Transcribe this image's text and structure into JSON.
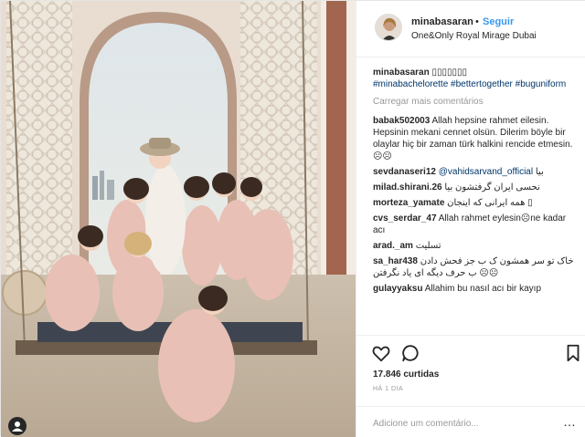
{
  "header": {
    "username": "minabasaran",
    "separator": "•",
    "follow_label": "Seguir",
    "location": "One&Only Royal Mirage Dubai"
  },
  "caption": {
    "user": "minabasaran",
    "text": "▯▯▯▯▯▯▯",
    "hashtags": "#minabachelorette #bettertogether #buguniform"
  },
  "load_more": "Carregar mais comentários",
  "comments": [
    {
      "user": "babak502003",
      "text": "Allah hepsine rahmet eilesin. Hepsinin mekani cennet olsün. Dilerim böyle bir olaylar hiç bir zaman türk halkini rencide etmesin. ☹☹",
      "mention": ""
    },
    {
      "user": "sevdanaseri12",
      "text": "بیا",
      "mention": "@vahidsarvand_official"
    },
    {
      "user": "milad.shirani.26",
      "text": "نحسی ایران گرفتشون بیا",
      "mention": ""
    },
    {
      "user": "morteza_yamate",
      "text": "همه ایرانی که اینجان ▯",
      "mention": ""
    },
    {
      "user": "cvs_serdar_47",
      "text": "Allah rahmet eylesin☹ne kadar acı",
      "mention": ""
    },
    {
      "user": "arad._am",
      "text": "تسلیت",
      "mention": ""
    },
    {
      "user": "sa_har438",
      "text": "خاک تو سر همشون ک ب جز فحش دادن ب حرف دیگه ای یاد نگرفتن ☹☹",
      "mention": ""
    },
    {
      "user": "gulayyaksu",
      "text": "Allahim bu nasıl acı bir kayıp",
      "mention": ""
    }
  ],
  "likes": "17.846 curtidas",
  "time": "HÁ 1 DIA",
  "add_comment_placeholder": "Adicione um comentário...",
  "more_icon": "…",
  "colors": {
    "link_blue": "#3897f0",
    "hashtag": "#003569",
    "muted": "#999999",
    "text": "#262626",
    "border": "#efefef"
  }
}
